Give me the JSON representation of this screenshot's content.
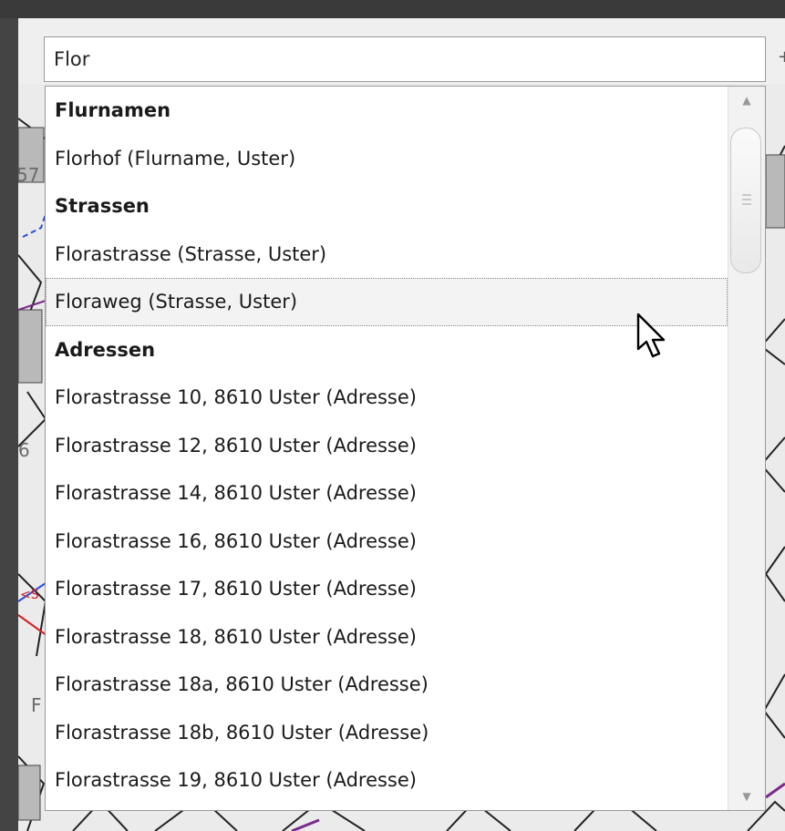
{
  "search": {
    "value": "Flor"
  },
  "results": [
    {
      "label": "Flurnamen",
      "kind": "header"
    },
    {
      "label": "Florhof (Flurname, Uster)",
      "kind": "item"
    },
    {
      "label": "Strassen",
      "kind": "header"
    },
    {
      "label": "Florastrasse (Strasse, Uster)",
      "kind": "item"
    },
    {
      "label": "Floraweg (Strasse, Uster)",
      "kind": "item",
      "hovered": true
    },
    {
      "label": "Adressen",
      "kind": "header"
    },
    {
      "label": "Florastrasse 10, 8610 Uster (Adresse)",
      "kind": "item"
    },
    {
      "label": "Florastrasse 12, 8610 Uster (Adresse)",
      "kind": "item"
    },
    {
      "label": "Florastrasse 14, 8610 Uster (Adresse)",
      "kind": "item"
    },
    {
      "label": "Florastrasse 16, 8610 Uster (Adresse)",
      "kind": "item"
    },
    {
      "label": "Florastrasse 17, 8610 Uster (Adresse)",
      "kind": "item"
    },
    {
      "label": "Florastrasse 18, 8610 Uster (Adresse)",
      "kind": "item"
    },
    {
      "label": "Florastrasse 18a, 8610 Uster (Adresse)",
      "kind": "item"
    },
    {
      "label": "Florastrasse 18b, 8610 Uster (Adresse)",
      "kind": "item"
    },
    {
      "label": "Florastrasse 19, 8610 Uster (Adresse)",
      "kind": "item"
    }
  ],
  "map_labels": {
    "a": "57",
    "b": "6",
    "c": "F",
    "d": "<S"
  },
  "scrollbar": {
    "up_icon": "triangle-up-icon",
    "down_icon": "triangle-down-icon",
    "position": 0.0
  },
  "colors": {
    "accent_blue": "#2b4bd9",
    "accent_purple": "#7a2a8a",
    "accent_red": "#d02020"
  }
}
